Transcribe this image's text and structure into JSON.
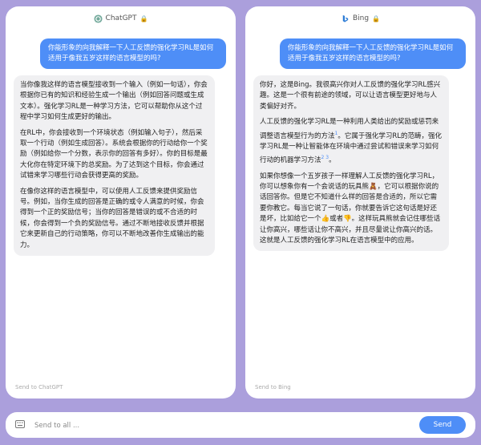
{
  "chatgpt": {
    "title": "ChatGPT",
    "user_message": "你能形象的向我解释一下人工反馈的强化学习RL是如何适用于像我五岁这样的语言模型的吗?",
    "answer": [
      "当你像我这样的语言模型接收到一个输入（例如一句话），你会根据你已有的知识和经验生成一个输出（例如回答问题或生成文本）。强化学习RL是一种学习方法，它可以帮助你从这个过程中学习如何生成更好的输出。",
      "在RL中，你会接收到一个环境状态（例如输入句子），然后采取一个行动（例如生成回答）。系统会根据你的行动给你一个奖励（例如给你一个分数，表示你的回答有多好）。你的目标是最大化你在特定环境下的总奖励。为了达到这个目标，你会通过试错来学习哪些行动会获得更高的奖励。",
      "在像你这样的语言模型中，可以使用人工反馈来提供奖励信号。例如，当你生成的回答是正确的或令人满意的时候，你会得到一个正的奖励信号；当你的回答是错误的或不合适的时候，你会得到一个负的奖励信号。通过不断地接收反馈并根据它来更新自己的行动策略，你可以不断地改善你生成输出的能力。"
    ],
    "send_to": "Send to ChatGPT"
  },
  "bing": {
    "title": "Bing",
    "user_message": "你能形象的向我解释一下人工反馈的强化学习RL是如何适用于像我五岁这样的语言模型的吗?",
    "p1": "你好，这是Bing。我很高兴你对人工反馈的强化学习RL感兴趣。这是一个很有前途的领域，可以让语言模型更好地与人类偏好对齐。",
    "p2": "人工反馈的强化学习RL是一种利用人类给出的奖励或惩罚来调整语言模型行为的方法",
    "p2_ref1": "1",
    "p2b": "。它属于强化学习RL的范畴，强化学习RL是一种让智能体在环境中通过尝试和错误来学习如何行动的机器学习方法",
    "p2_ref2": "2 3",
    "p2c": "。",
    "p3": "如果你想像一个五岁孩子一样理解人工反馈的强化学习RL，你可以想象你有一个会说话的玩具熊🧸，它可以根据你说的话回答你。但是它不知道什么样的回答是合适的，所以它需要你教它。每当它说了一句话，你就要告诉它这句话是好还是坏，比如给它一个👍或者👎。这样玩具熊就会记住哪些话让你高兴，哪些话让你不高兴，并且尽量说让你高兴的话。这就是人工反馈的强化学习RL在语言模型中的应用。",
    "send_to": "Send to Bing"
  },
  "input": {
    "placeholder": "Send to all ...",
    "send_label": "Send"
  },
  "colors": {
    "accent": "#4e8ef7",
    "background": "#ab9fdc"
  }
}
